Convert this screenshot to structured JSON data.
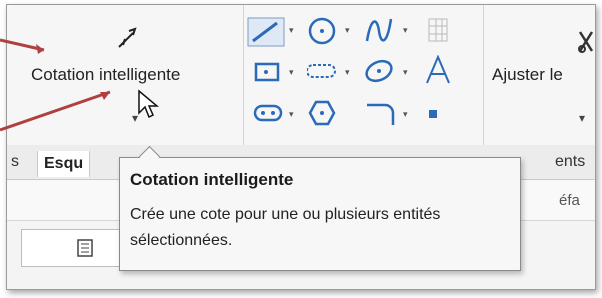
{
  "ribbon": {
    "smart_dimension_label": "Cotation intelligente",
    "ajuster_label": "Ajuster le",
    "tools": [
      "line-icon",
      "circle-icon",
      "spline-icon",
      "rectangle-icon",
      "polygon-icon",
      "ellipse-icon",
      "text-icon",
      "slot-icon",
      "hexagon-icon",
      "fillet-icon",
      "point-icon",
      "grid-icon"
    ]
  },
  "tabs": {
    "partial_left": "s",
    "sketch_tab": "Esqu",
    "partial_right": "ents"
  },
  "row3": {
    "partial_right": "éfa"
  },
  "tooltip": {
    "title": "Cotation intelligente",
    "description": "Crée une cote pour une ou plusieurs entités sélectionnées."
  },
  "colors": {
    "annotation_arrow": "#b04040",
    "accent": "#2a6ab8"
  }
}
